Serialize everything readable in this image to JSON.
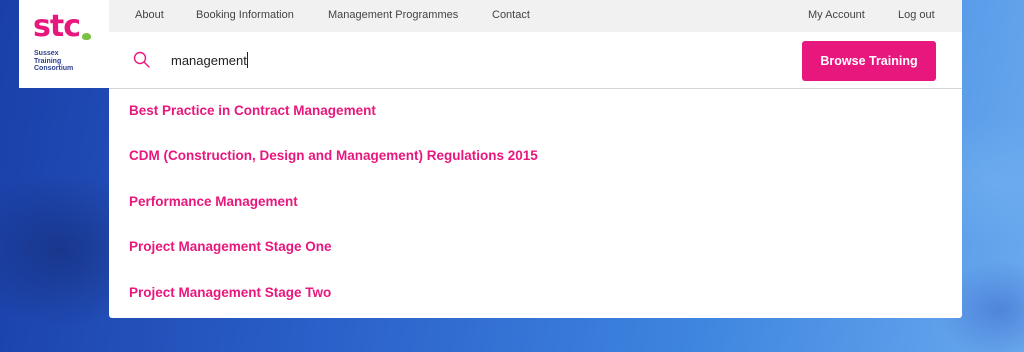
{
  "logo": {
    "text": "stc",
    "subtitle": [
      "Sussex",
      "Training",
      "Consortium"
    ]
  },
  "nav": {
    "left": [
      "About",
      "Booking Information",
      "Management Programmes",
      "Contact"
    ],
    "right": [
      "My Account",
      "Log out"
    ]
  },
  "search": {
    "value": "management",
    "icon": "search-icon",
    "button_label": "Browse Training"
  },
  "results": [
    "Best Practice in Contract Management",
    "CDM (Construction, Design and Management) Regulations 2015",
    "Performance Management",
    "Project Management Stage One",
    "Project Management Stage Two"
  ],
  "colors": {
    "accent": "#e8177d",
    "logo_text": "#2a3d8f",
    "nav_bg": "#f1f1f1"
  }
}
